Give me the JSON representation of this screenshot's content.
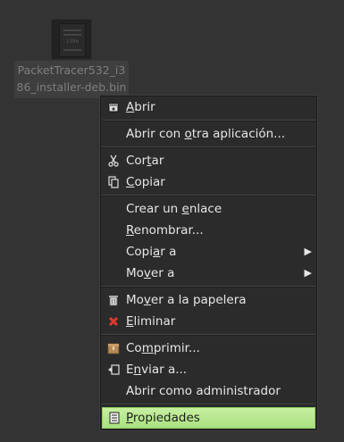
{
  "desktop": {
    "icon_label": "PacketTracer532_i386_installer-deb.bin",
    "icon_thumb_text": "i386"
  },
  "menu": {
    "items": [
      {
        "pre": "",
        "mn": "A",
        "post": "brir",
        "icon": "open-icon"
      },
      {
        "pre": "Abrir con ",
        "mn": "o",
        "post": "tra aplicación...",
        "icon": ""
      },
      {
        "pre": "Cor",
        "mn": "t",
        "post": "ar",
        "icon": "scissors-icon"
      },
      {
        "pre": "",
        "mn": "C",
        "post": "opiar",
        "icon": "copy-icon"
      },
      {
        "pre": "Crear un ",
        "mn": "e",
        "post": "nlace",
        "icon": ""
      },
      {
        "pre": "",
        "mn": "R",
        "post": "enombrar...",
        "icon": ""
      },
      {
        "pre": "Copi",
        "mn": "a",
        "post": "r a",
        "icon": "",
        "arrow": "▶"
      },
      {
        "pre": "Mo",
        "mn": "v",
        "post": "er a",
        "icon": "",
        "arrow": "▶"
      },
      {
        "pre": "Mo",
        "mn": "v",
        "post": "er a la papelera",
        "icon": "trash-icon"
      },
      {
        "pre": "",
        "mn": "E",
        "post": "liminar",
        "icon": "delete-icon"
      },
      {
        "pre": "Co",
        "mn": "m",
        "post": "primir...",
        "icon": "archive-icon"
      },
      {
        "pre": "E",
        "mn": "n",
        "post": "viar a...",
        "icon": "send-icon"
      },
      {
        "pre": "Abrir como administrador",
        "mn": "",
        "post": "",
        "icon": ""
      },
      {
        "pre": "",
        "mn": "P",
        "post": "ropiedades",
        "icon": "properties-icon"
      }
    ]
  },
  "colors": {
    "highlight": "#b6e78e",
    "menu_bg": "#2b2b2b",
    "desktop_bg": "#333333"
  }
}
